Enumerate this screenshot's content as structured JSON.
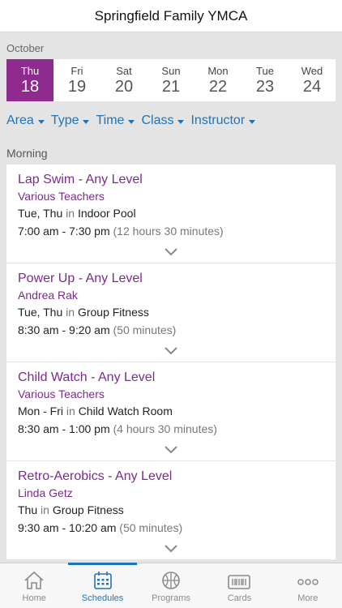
{
  "header": {
    "title": "Springfield Family YMCA"
  },
  "month": "October",
  "days": [
    {
      "dow": "Thu",
      "num": "18",
      "selected": true
    },
    {
      "dow": "Fri",
      "num": "19"
    },
    {
      "dow": "Sat",
      "num": "20"
    },
    {
      "dow": "Sun",
      "num": "21"
    },
    {
      "dow": "Mon",
      "num": "22"
    },
    {
      "dow": "Tue",
      "num": "23"
    },
    {
      "dow": "Wed",
      "num": "24"
    }
  ],
  "filters": [
    "Area",
    "Type",
    "Time",
    "Class",
    "Instructor"
  ],
  "section": "Morning",
  "classes": [
    {
      "name": "Lap Swim - Any Level",
      "teacher": "Various Teachers",
      "days": "Tue, Thu",
      "in": "in",
      "location": "Indoor Pool",
      "time": "7:00 am - 7:30 pm",
      "duration": "(12 hours 30 minutes)"
    },
    {
      "name": "Power Up - Any Level",
      "teacher": "Andrea Rak",
      "days": "Tue, Thu",
      "in": "in",
      "location": "Group Fitness",
      "time": "8:30 am - 9:20 am",
      "duration": "(50 minutes)"
    },
    {
      "name": "Child Watch - Any Level",
      "teacher": "Various Teachers",
      "days": "Mon - Fri",
      "in": "in",
      "location": "Child Watch Room",
      "time": "8:30 am - 1:00 pm",
      "duration": "(4 hours 30 minutes)"
    },
    {
      "name": "Retro-Aerobics - Any Level",
      "teacher": "Linda Getz",
      "days": "Thu",
      "in": "in",
      "location": "Group Fitness",
      "time": "9:30 am - 10:20 am",
      "duration": "(50 minutes)"
    }
  ],
  "tabs": [
    {
      "label": "Home",
      "icon": "home-icon"
    },
    {
      "label": "Schedules",
      "icon": "calendar-icon",
      "active": true
    },
    {
      "label": "Programs",
      "icon": "basketball-icon"
    },
    {
      "label": "Cards",
      "icon": "barcode-card-icon"
    },
    {
      "label": "More",
      "icon": "more-icon"
    }
  ],
  "colors": {
    "accent": "#8f2a8f",
    "link": "#1f74b8",
    "class_text": "#7b2b8b"
  }
}
